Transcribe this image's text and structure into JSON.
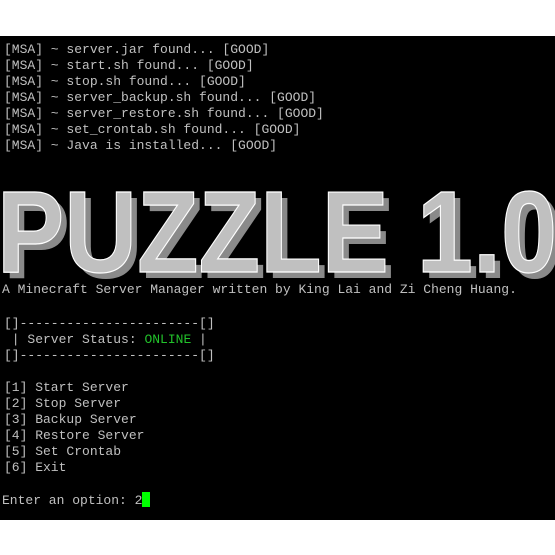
{
  "startup_checks": [
    "[MSA] ~ server.jar found... [GOOD]",
    "[MSA] ~ start.sh found... [GOOD]",
    "[MSA] ~ stop.sh found... [GOOD]",
    "[MSA] ~ server_backup.sh found... [GOOD]",
    "[MSA] ~ server_restore.sh found... [GOOD]",
    "[MSA] ~ set_crontab.sh found... [GOOD]",
    "[MSA] ~ Java is installed... [GOOD]"
  ],
  "banner": {
    "text": "PUZZLE 1.0",
    "face_color": "#c0c0c0",
    "shadow_color": "#8a8a8a"
  },
  "subtitle": "A Minecraft Server Manager written by King Lai and Zi Cheng Huang.",
  "status_box": {
    "top_border": "[]-----------------------[]",
    "label_prefix": " | Server Status: ",
    "status": "ONLINE",
    "label_suffix": " |",
    "bottom_border": "[]-----------------------[]",
    "status_color": "#22c22b"
  },
  "menu": [
    "[1] Start Server",
    "[2] Stop Server",
    "[3] Backup Server",
    "[4] Restore Server",
    "[5] Set Crontab",
    "[6] Exit"
  ],
  "prompt": {
    "label": "Enter an option: ",
    "value": "2",
    "cursor_color": "#00ff00"
  }
}
